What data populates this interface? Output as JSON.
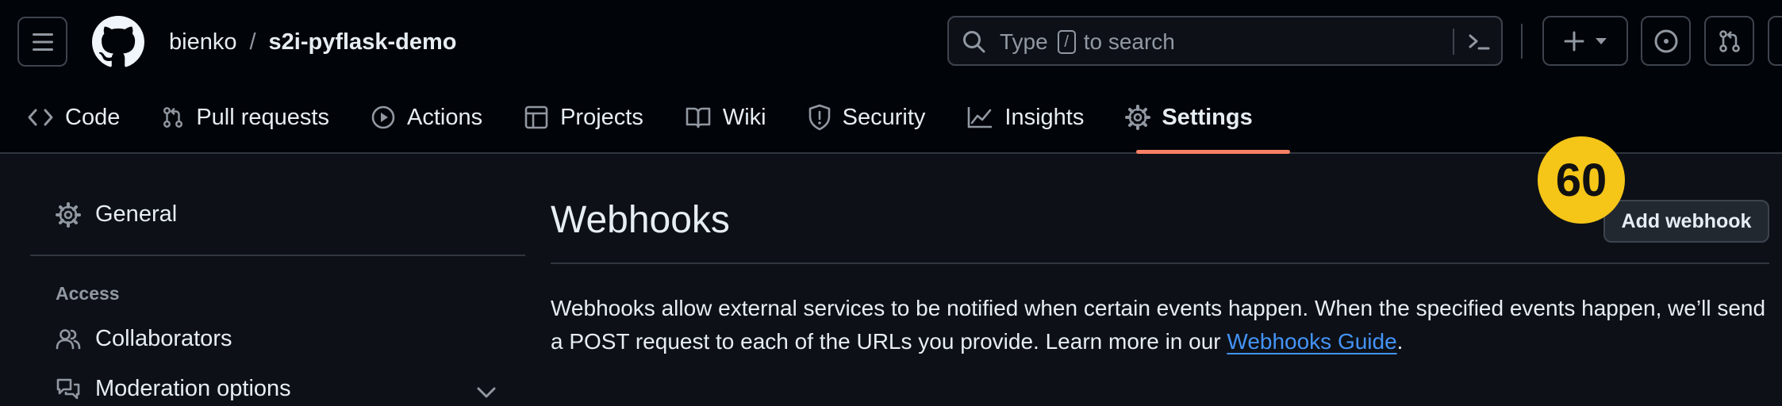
{
  "header": {
    "owner": "bienko",
    "separator": "/",
    "repo_name": "s2i-pyflask-demo",
    "search": {
      "prefix": "Type",
      "key": "/",
      "suffix": "to search"
    }
  },
  "nav": {
    "items": [
      {
        "label": "Code",
        "icon": "code-icon"
      },
      {
        "label": "Pull requests",
        "icon": "git-pull-request-icon"
      },
      {
        "label": "Actions",
        "icon": "play-icon"
      },
      {
        "label": "Projects",
        "icon": "table-icon"
      },
      {
        "label": "Wiki",
        "icon": "book-icon"
      },
      {
        "label": "Security",
        "icon": "shield-icon"
      },
      {
        "label": "Insights",
        "icon": "graph-icon"
      },
      {
        "label": "Settings",
        "icon": "gear-icon",
        "active": true
      }
    ]
  },
  "sidebar": {
    "general": "General",
    "access_heading": "Access",
    "collaborators": "Collaborators",
    "moderation": "Moderation options"
  },
  "main": {
    "title": "Webhooks",
    "add_button": "Add webhook",
    "badge": "60",
    "description_text": "Webhooks allow external services to be notified when certain events happen. When the specified events happen, we’ll send a POST request to each of the URLs you provide. Learn more in our ",
    "guide_link": "Webhooks Guide",
    "description_end": "."
  },
  "colors": {
    "accent_underline": "#f78166",
    "link": "#4493f8",
    "badge": "#f5c518"
  }
}
